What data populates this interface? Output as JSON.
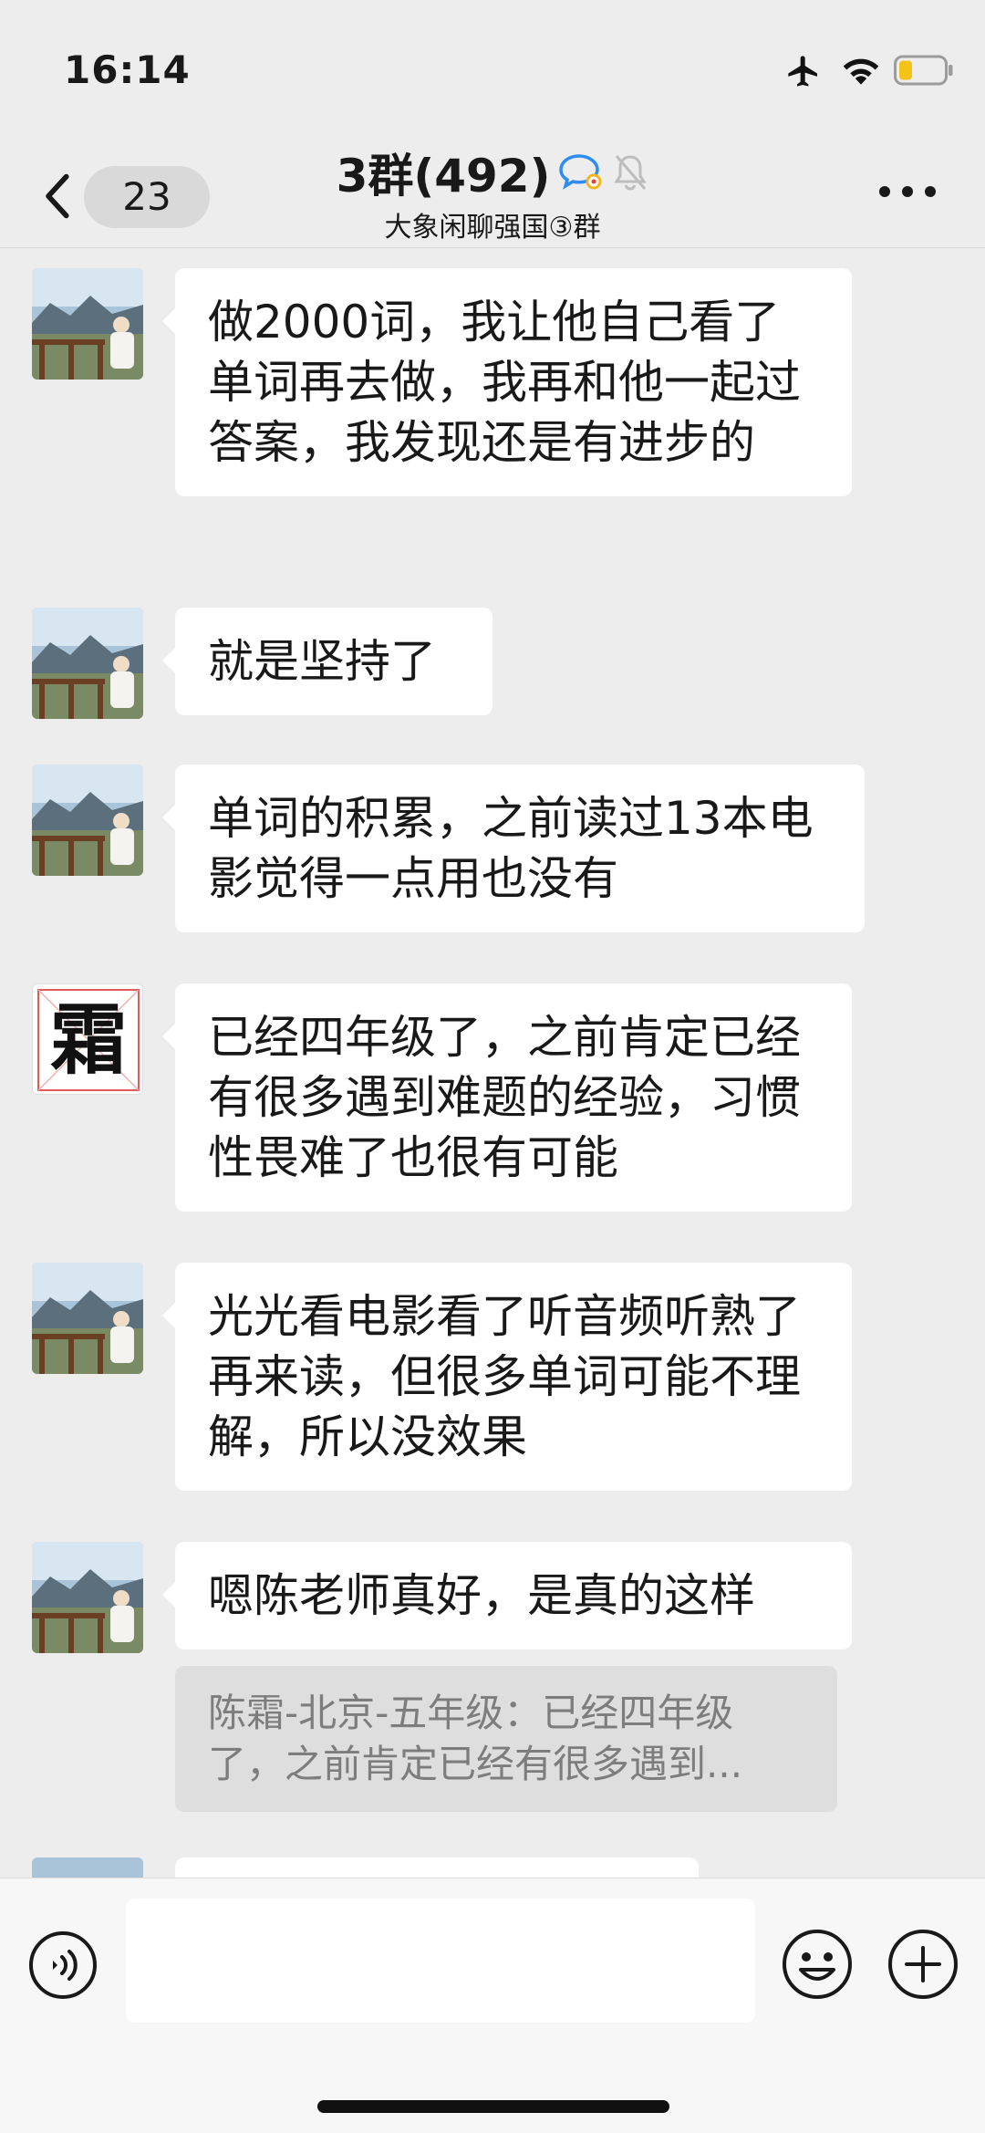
{
  "status_bar": {
    "time": "16:14",
    "icons": [
      "airplane-icon",
      "wifi-icon",
      "battery-icon"
    ],
    "battery_color": "#f3c316"
  },
  "header": {
    "unread_count": "23",
    "title": "3群(492)",
    "subtitle": "大象闲聊强国③群",
    "icons": [
      "chevron-left-icon",
      "chat-bubble-icon",
      "muted-bell-icon",
      "more-icon"
    ]
  },
  "messages": [
    {
      "avatar": "landscape-avatar",
      "text": "做2000词，我让他自己看了单词再去做，我再和他一起过答案，我发现还是有进步的"
    },
    {
      "avatar": "landscape-avatar",
      "text": "就是坚持了"
    },
    {
      "avatar": "landscape-avatar",
      "text": "单词的积累，之前读过13本电影觉得一点用也没有"
    },
    {
      "avatar": "calligraphy-avatar",
      "avatar_char": "霜",
      "text": "已经四年级了，之前肯定已经有很多遇到难题的经验，习惯性畏难了也很有可能"
    },
    {
      "avatar": "landscape-avatar",
      "text": "光光看电影看了听音频听熟了再来读，但很多单词可能不理解，所以没效果"
    },
    {
      "avatar": "landscape-avatar",
      "text": "嗯陈老师真好，是真的这样",
      "quote": "陈霜-北京-五年级：已经四年级了，之前肯定已经有很多遇到..."
    }
  ],
  "input_bar": {
    "icons": [
      "voice-icon",
      "emoji-icon",
      "add-icon"
    ],
    "value": ""
  },
  "colors": {
    "background": "#ededed",
    "bubble": "#ffffff",
    "quote_bg": "#dedede",
    "text": "#191919",
    "quote_text": "#7d7d7d"
  }
}
